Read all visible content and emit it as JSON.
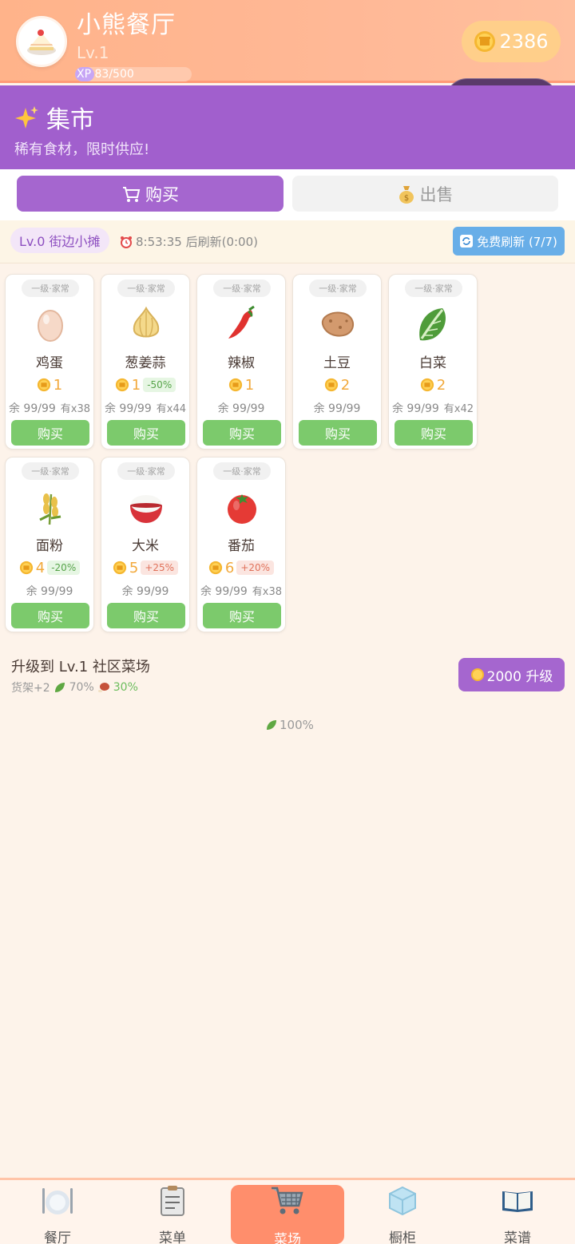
{
  "header": {
    "restaurant_name": "小熊餐厅",
    "level": "Lv.1",
    "xp_label": "XP",
    "xp_text": "83/500",
    "xp_progress": 0.166,
    "coins": "2386"
  },
  "market": {
    "title": "集市",
    "subtitle": "稀有食材，限时供应!"
  },
  "tabs": {
    "buy": "购买",
    "sell": "出售"
  },
  "stall": {
    "badge": "Lv.0 街边小摊",
    "timer": "8:53:35 后刷新(0:00)",
    "refresh_button": "免费刷新 (7/7)"
  },
  "items": [
    {
      "tier": "一级·家常",
      "icon": "egg-icon",
      "name": "鸡蛋",
      "price": "1",
      "discount": "",
      "stock": "余 99/99",
      "owned": "有x38",
      "buy": "购买"
    },
    {
      "tier": "一级·家常",
      "icon": "onion-garlic-icon",
      "name": "葱姜蒜",
      "price": "1",
      "discount": "-50%",
      "stock": "余 99/99",
      "owned": "有x44",
      "buy": "购买"
    },
    {
      "tier": "一级·家常",
      "icon": "chili-icon",
      "name": "辣椒",
      "price": "1",
      "discount": "",
      "stock": "余 99/99",
      "owned": "",
      "buy": "购买"
    },
    {
      "tier": "一级·家常",
      "icon": "potato-icon",
      "name": "土豆",
      "price": "2",
      "discount": "",
      "stock": "余 99/99",
      "owned": "",
      "buy": "购买"
    },
    {
      "tier": "一级·家常",
      "icon": "cabbage-icon",
      "name": "白菜",
      "price": "2",
      "discount": "",
      "stock": "余 99/99",
      "owned": "有x42",
      "buy": "购买"
    },
    {
      "tier": "一级·家常",
      "icon": "wheat-icon",
      "name": "面粉",
      "price": "4",
      "discount": "-20%",
      "stock": "余 99/99",
      "owned": "",
      "buy": "购买"
    },
    {
      "tier": "一级·家常",
      "icon": "rice-icon",
      "name": "大米",
      "price": "5",
      "discount": "+25%",
      "stock": "余 99/99",
      "owned": "",
      "buy": "购买"
    },
    {
      "tier": "一级·家常",
      "icon": "tomato-icon",
      "name": "番茄",
      "price": "6",
      "discount": "+20%",
      "stock": "余 99/99",
      "owned": "有x38",
      "buy": "购买"
    }
  ],
  "upgrade": {
    "title": "升级到 Lv.1 社区菜场",
    "shelf": "货架+2",
    "bonus_a": "70%",
    "bonus_b": "30%",
    "button": "2000 升级",
    "extra": "100%"
  },
  "nav": [
    {
      "label": "餐厅",
      "icon": "restaurant-icon"
    },
    {
      "label": "菜单",
      "icon": "menu-clipboard-icon"
    },
    {
      "label": "菜场",
      "icon": "cart-icon"
    },
    {
      "label": "橱柜",
      "icon": "ice-cabinet-icon"
    },
    {
      "label": "菜谱",
      "icon": "recipe-book-icon"
    }
  ],
  "colors": {
    "accent_purple": "#a566cf",
    "buy_green": "#7cca6c",
    "coin_gold": "#f2a93b",
    "active_nav": "#ff8e6c"
  }
}
